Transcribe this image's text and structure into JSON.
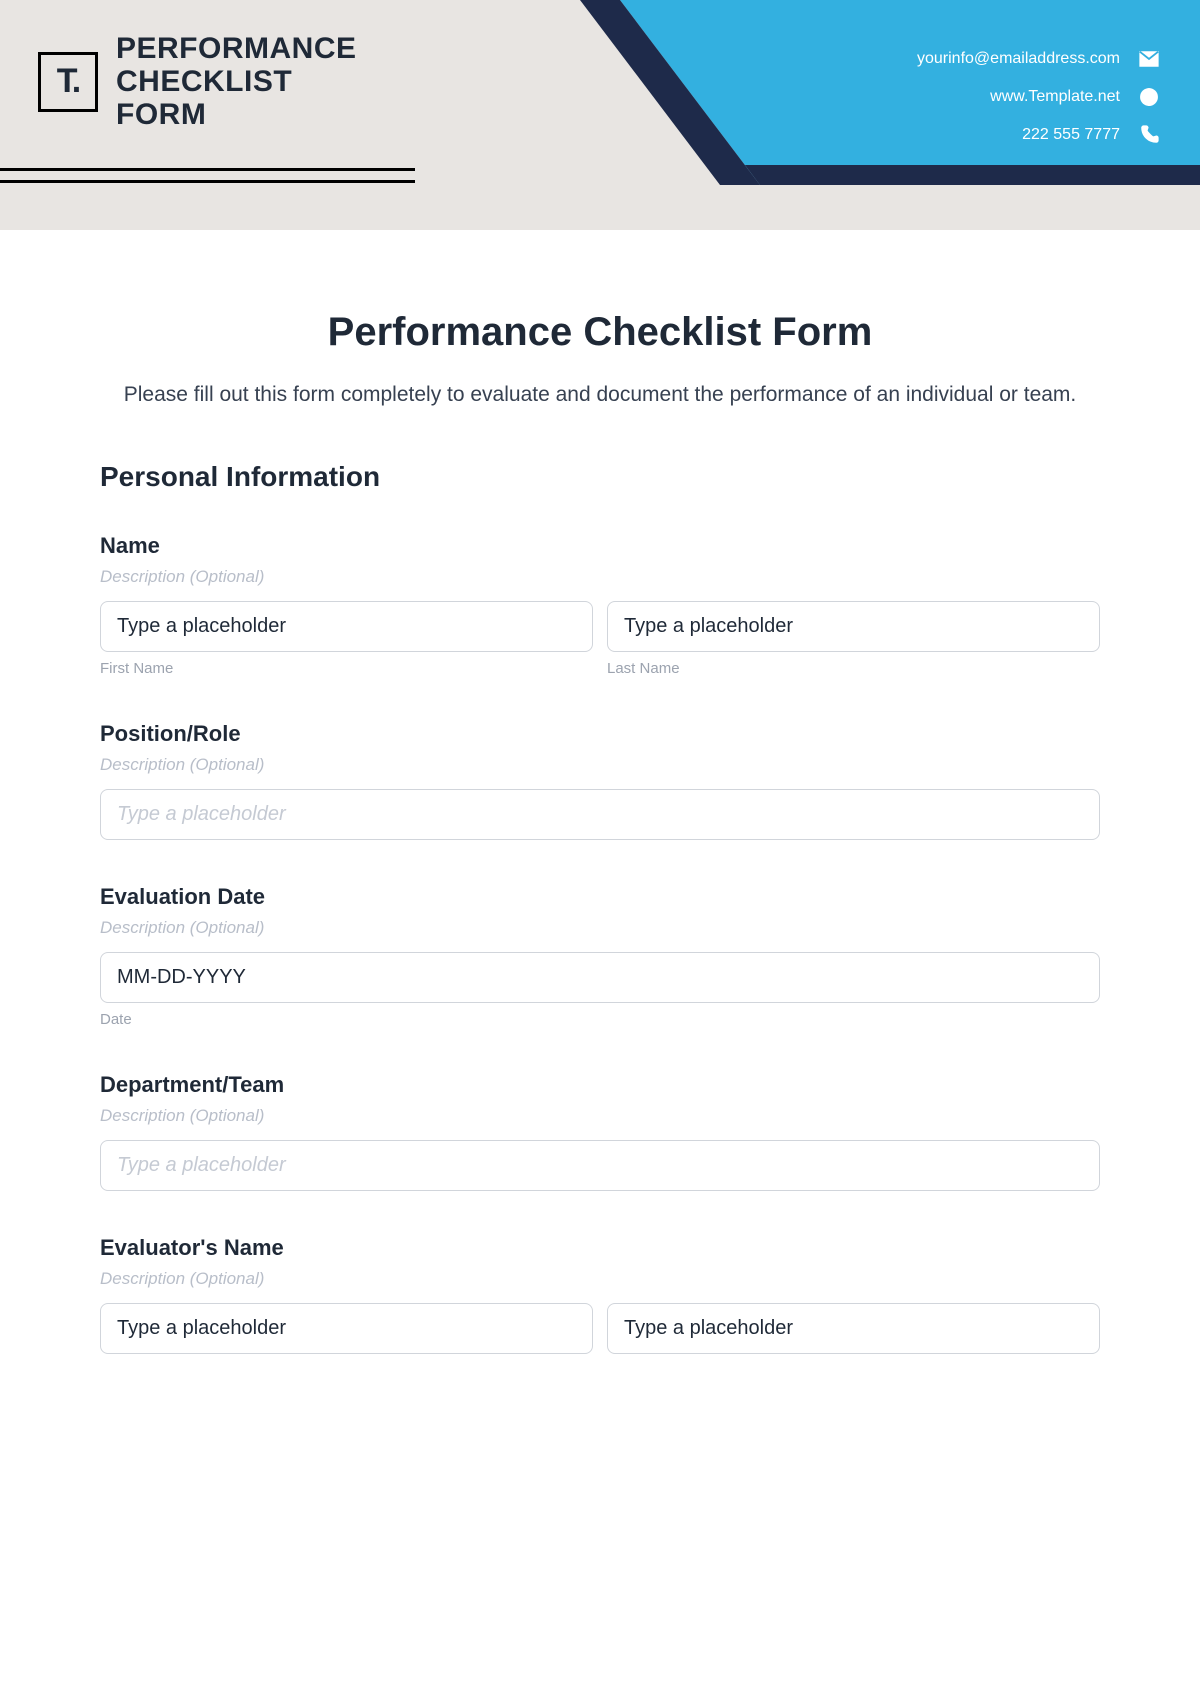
{
  "banner": {
    "logo_text": "T.",
    "title_line1": "PERFORMANCE",
    "title_line2": "CHECKLIST",
    "title_line3": "FORM",
    "email": "yourinfo@emailaddress.com",
    "website": "www.Template.net",
    "phone": "222 555 7777"
  },
  "form": {
    "title": "Performance Checklist Form",
    "intro": "Please fill out this form completely to evaluate and document the performance of an individual or team.",
    "section_personal": "Personal Information",
    "fields": {
      "name": {
        "label": "Name",
        "desc": "Description (Optional)",
        "first_ph": "Type a placeholder",
        "last_ph": "Type a placeholder",
        "first_sub": "First Name",
        "last_sub": "Last Name"
      },
      "position": {
        "label": "Position/Role",
        "desc": "Description (Optional)",
        "ph": "Type a placeholder"
      },
      "eval_date": {
        "label": "Evaluation Date",
        "desc": "Description (Optional)",
        "ph": "MM-DD-YYYY",
        "sub": "Date"
      },
      "department": {
        "label": "Department/Team",
        "desc": "Description (Optional)",
        "ph": "Type a placeholder"
      },
      "evaluator": {
        "label": "Evaluator's Name",
        "desc": "Description (Optional)",
        "first_ph": "Type a placeholder",
        "last_ph": "Type a placeholder"
      }
    }
  }
}
